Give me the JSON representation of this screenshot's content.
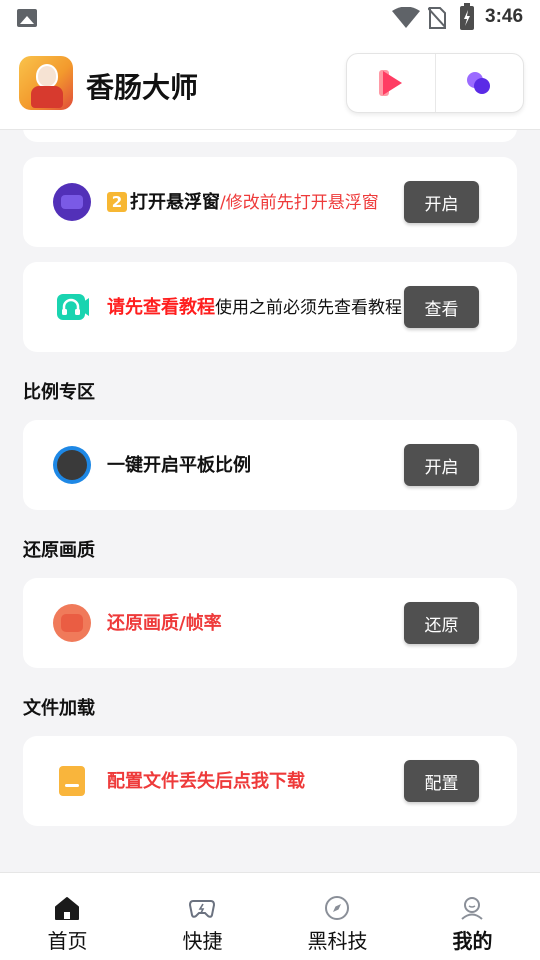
{
  "status_bar": {
    "time": "3:46"
  },
  "header": {
    "app_title": "香肠大师",
    "buttons": [
      {
        "icon": "play-icon"
      },
      {
        "icon": "bubbles-icon"
      }
    ]
  },
  "cards": {
    "float_window": {
      "badge": "2",
      "title": "打开悬浮窗",
      "subtitle": "/修改前先打开悬浮窗",
      "button": "开启"
    },
    "tutorial": {
      "title": "请先查看教程",
      "subtitle": "使用之前必须先查看教程",
      "button": "查看"
    },
    "tablet_ratio": {
      "title": "一键开启平板比例",
      "button": "开启"
    },
    "restore_quality": {
      "title": "还原画质/帧率",
      "button": "还原"
    },
    "config_download": {
      "title": "配置文件丢失后点我下载",
      "button": "配置"
    }
  },
  "sections": {
    "ratio": "比例专区",
    "quality": "还原画质",
    "file": "文件加载"
  },
  "bottom_nav": [
    {
      "label": "首页",
      "icon": "home-icon",
      "active": false
    },
    {
      "label": "快捷",
      "icon": "gamepad-icon",
      "active": false
    },
    {
      "label": "黑科技",
      "icon": "compass-icon",
      "active": false
    },
    {
      "label": "我的",
      "icon": "profile-icon",
      "active": true
    }
  ],
  "colors": {
    "accent_red": "#ff1e1e",
    "button_bg": "#505050",
    "background": "#f4f4f6"
  }
}
